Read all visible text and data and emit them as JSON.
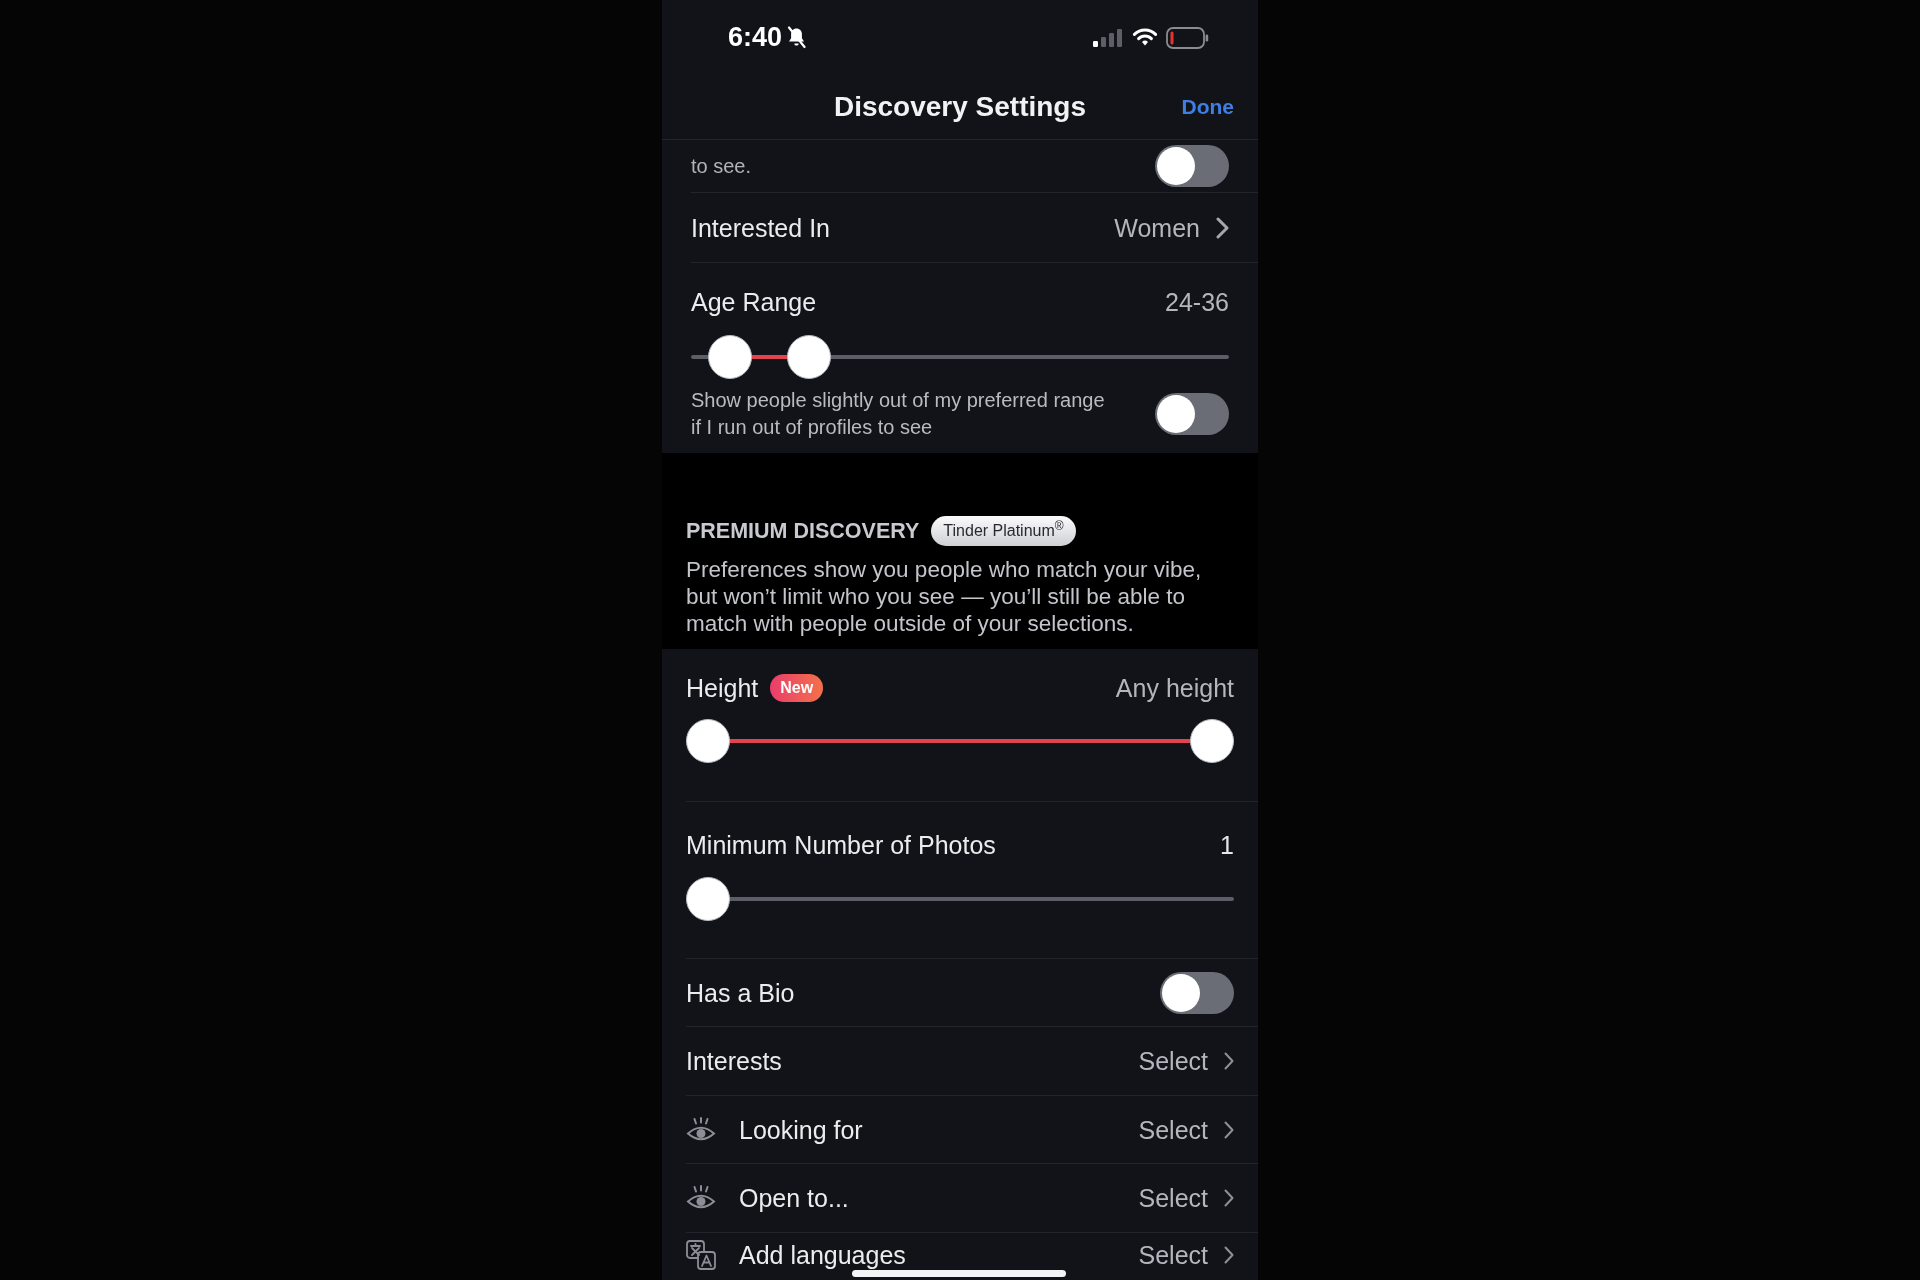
{
  "status_bar": {
    "time": "6:40"
  },
  "header": {
    "title": "Discovery Settings",
    "done": "Done"
  },
  "distance": {
    "text": "to see.",
    "on": false
  },
  "interested_in": {
    "label": "Interested In",
    "value": "Women"
  },
  "age_range": {
    "label": "Age Range",
    "value": "24-36",
    "range": [
      {
        "level": 0.035
      },
      {
        "level": 0.195
      }
    ],
    "expand": {
      "text": "Show people slightly out of my preferred range if I run out of profiles to see",
      "on": false
    }
  },
  "premium": {
    "title": "PREMIUM DISCOVERY",
    "badge": "Tinder Platinum$^{®}$",
    "description": "Preferences show you people who match your vibe, but won’t limit who you see — you’ll still be able to match with people outside of your selections."
  },
  "height": {
    "label": "Height",
    "badge": "New",
    "value": "Any height",
    "range": [
      {
        "level": 0
      },
      {
        "level": 1
      }
    ]
  },
  "min_photos": {
    "label": "Minimum Number of Photos",
    "value": "1",
    "level": 0
  },
  "rows": [
    {
      "kind": "toggle",
      "label": "Has a Bio",
      "on": false
    },
    {
      "kind": "select",
      "label": "Interests",
      "value": "Select"
    },
    {
      "kind": "eye",
      "label": "Looking for",
      "value": "Select"
    },
    {
      "kind": "eye",
      "label": "Open to...",
      "value": "Select"
    },
    {
      "kind": "lang",
      "label": "Add languages",
      "value": "Select"
    }
  ]
}
